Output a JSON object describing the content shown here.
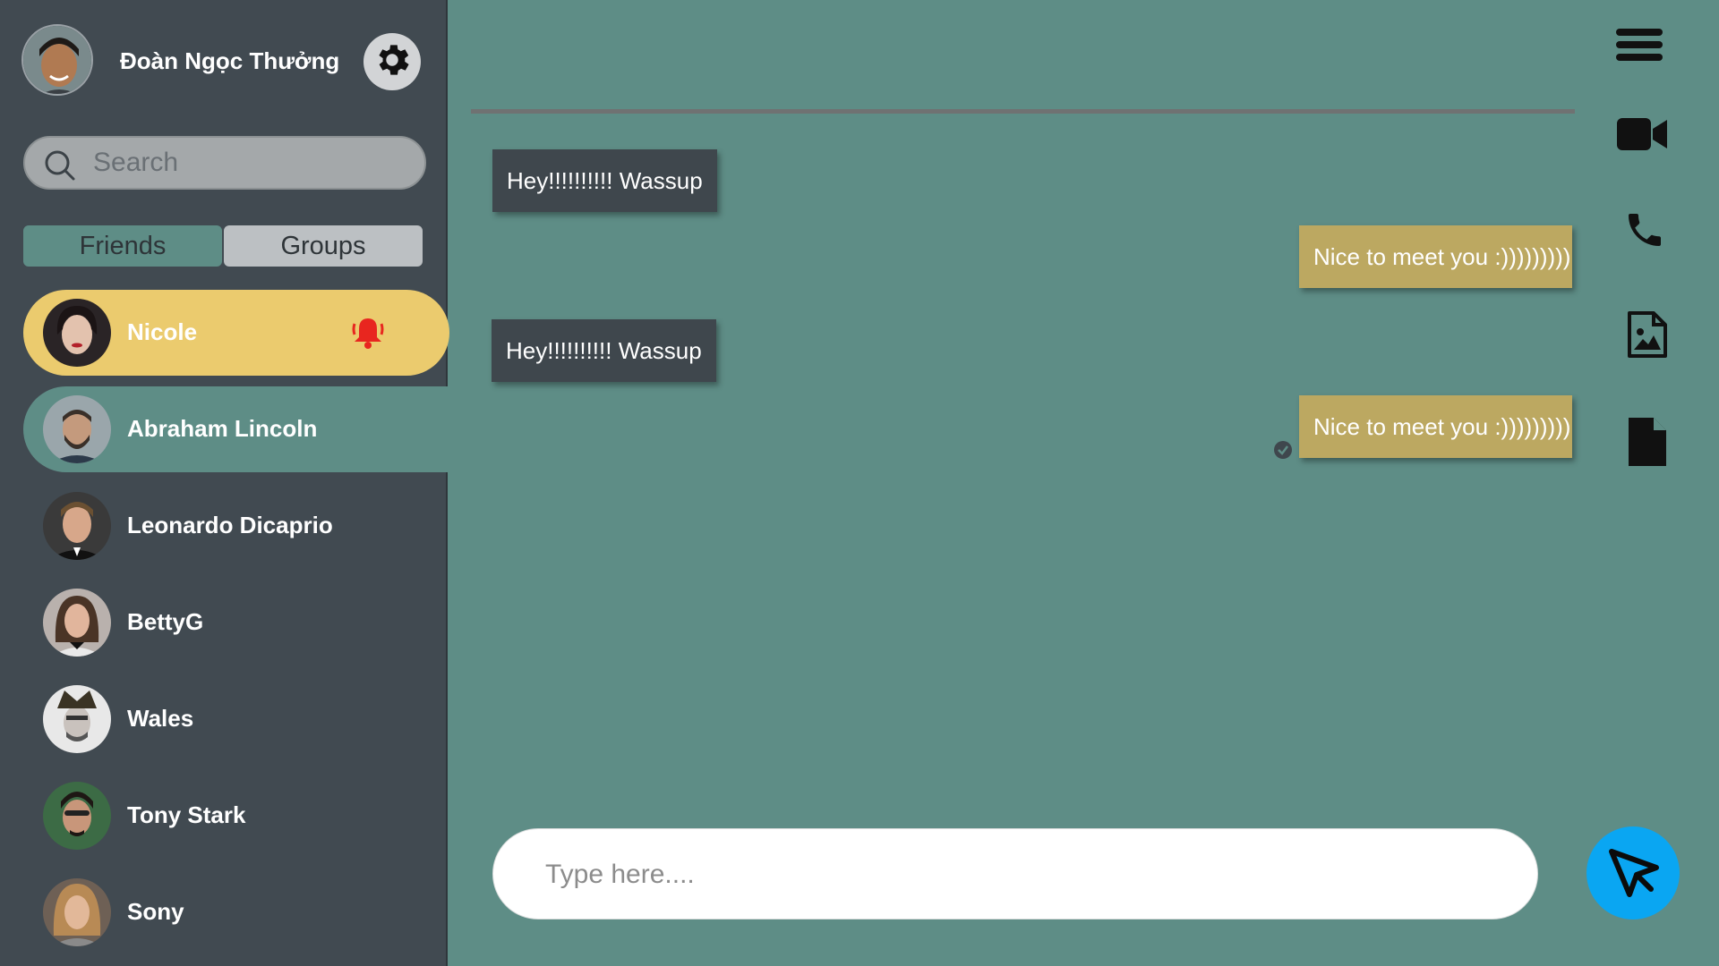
{
  "profile": {
    "name": "Đoàn Ngọc Thưởng"
  },
  "search": {
    "placeholder": "Search"
  },
  "tabs": [
    {
      "label": "Friends",
      "active": true
    },
    {
      "label": "Groups",
      "active": false
    }
  ],
  "contacts": [
    {
      "name": "Nicole",
      "state": "notification"
    },
    {
      "name": "Abraham Lincoln",
      "state": "selected"
    },
    {
      "name": "Leonardo Dicaprio",
      "state": ""
    },
    {
      "name": "BettyG",
      "state": ""
    },
    {
      "name": "Wales",
      "state": ""
    },
    {
      "name": "Tony Stark",
      "state": ""
    },
    {
      "name": "Sony",
      "state": ""
    }
  ],
  "messages": [
    {
      "direction": "incoming",
      "text": "Hey!!!!!!!!!! Wassup"
    },
    {
      "direction": "outgoing",
      "text": "Nice to meet you :)))))))))"
    },
    {
      "direction": "incoming",
      "text": "Hey!!!!!!!!!! Wassup"
    },
    {
      "direction": "outgoing",
      "text": "Nice to meet you :)))))))))",
      "seen": true
    }
  ],
  "composer": {
    "placeholder": "Type here...."
  },
  "rail_icons": [
    "menu-icon",
    "video-call-icon",
    "phone-icon",
    "image-file-icon",
    "file-icon"
  ],
  "colors": {
    "sidebar": "#414a51",
    "chat_background": "#5e8d86",
    "active_contact": "#ebcb6e",
    "incoming_bubble": "#3f474d",
    "outgoing_bubble": "#bca861",
    "send_button": "#0aa6f2",
    "notification": "#e8261f"
  }
}
